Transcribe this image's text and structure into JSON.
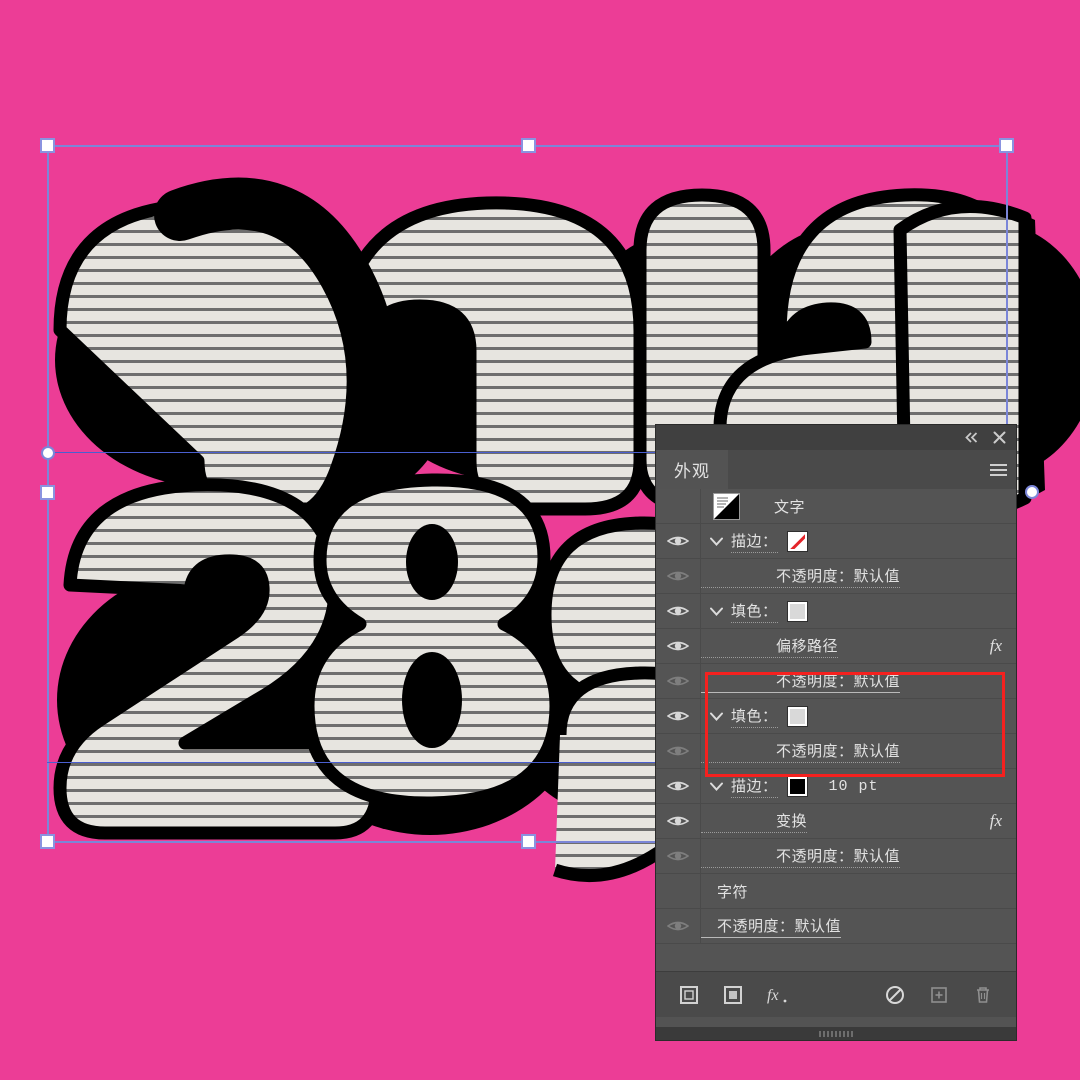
{
  "app": {
    "canvas_background_color": "#ec3d96",
    "selection_color": "#7b86d8",
    "highlight_color": "#f5211f"
  },
  "artwork": {
    "line1_text": "niau",
    "line2_text": "28g",
    "fill_color": "#e3e1dc",
    "shadow_color": "#000000",
    "stripe_color": "#6b6b6b",
    "outline_color": "#000000"
  },
  "panel": {
    "title_bar": {
      "collapse_label": "«",
      "close_label": "×"
    },
    "tab_label": "外观",
    "menu_label": "面板菜单",
    "rows": [
      {
        "id": "type-object",
        "label": "文字",
        "kind": "object",
        "has_eye": false,
        "has_disclosure": false,
        "has_thumb": true,
        "indent": 0
      },
      {
        "id": "stroke-1",
        "label": "描边：",
        "kind": "stroke",
        "has_eye": true,
        "eye_state": "on",
        "has_disclosure": true,
        "swatch": "none",
        "indent": 16
      },
      {
        "id": "stroke-1-opacity",
        "label": "不透明度：默认值",
        "kind": "opacity",
        "has_eye": true,
        "eye_state": "dim",
        "has_disclosure": false,
        "indent": 75
      },
      {
        "id": "fill-1",
        "label": "填色：",
        "kind": "fill",
        "has_eye": true,
        "eye_state": "on",
        "has_disclosure": true,
        "swatch": "white",
        "indent": 16,
        "highlighted": true
      },
      {
        "id": "fill-1-offset-path",
        "label": "偏移路径",
        "kind": "effect",
        "has_eye": true,
        "eye_state": "on",
        "has_disclosure": false,
        "fx": "fx",
        "indent": 75,
        "highlighted": true
      },
      {
        "id": "fill-1-opacity",
        "label": "不透明度：默认值",
        "kind": "opacity",
        "has_eye": true,
        "eye_state": "dim",
        "has_disclosure": false,
        "indent": 75,
        "highlighted": true
      },
      {
        "id": "fill-2",
        "label": "填色：",
        "kind": "fill",
        "has_eye": true,
        "eye_state": "on",
        "has_disclosure": true,
        "swatch": "white",
        "indent": 16
      },
      {
        "id": "fill-2-opacity",
        "label": "不透明度：默认值",
        "kind": "opacity",
        "has_eye": true,
        "eye_state": "dim",
        "has_disclosure": false,
        "indent": 75
      },
      {
        "id": "stroke-2",
        "label": "描边：",
        "kind": "stroke",
        "has_eye": true,
        "eye_state": "on",
        "has_disclosure": true,
        "swatch": "black",
        "value": "10 pt",
        "indent": 16
      },
      {
        "id": "stroke-2-transform",
        "label": "变换",
        "kind": "effect",
        "has_eye": true,
        "eye_state": "on",
        "has_disclosure": false,
        "fx": "fx",
        "indent": 75
      },
      {
        "id": "stroke-2-opacity",
        "label": "不透明度：默认值",
        "kind": "opacity",
        "has_eye": true,
        "eye_state": "dim",
        "has_disclosure": false,
        "indent": 75
      },
      {
        "id": "character",
        "label": "字符",
        "kind": "group",
        "has_eye": false,
        "has_disclosure": false,
        "indent": 60
      },
      {
        "id": "object-opacity",
        "label": "不透明度：默认值",
        "kind": "opacity",
        "has_eye": true,
        "eye_state": "dim",
        "has_disclosure": false,
        "indent": 60
      }
    ],
    "footer_buttons": [
      {
        "id": "add-new-stroke",
        "icon": "square-outline-icon",
        "label": "添加新描边"
      },
      {
        "id": "add-new-fill",
        "icon": "square-filled-icon",
        "label": "添加新填色"
      },
      {
        "id": "add-effect",
        "icon": "fx-icon",
        "label": "添加新效果"
      },
      {
        "id": "clear-appearance",
        "icon": "no-symbol-icon",
        "label": "清除外观"
      },
      {
        "id": "duplicate-item",
        "icon": "duplicate-icon",
        "label": "复制所选项目"
      },
      {
        "id": "delete-item",
        "icon": "trash-icon",
        "label": "删除所选项目"
      }
    ]
  }
}
